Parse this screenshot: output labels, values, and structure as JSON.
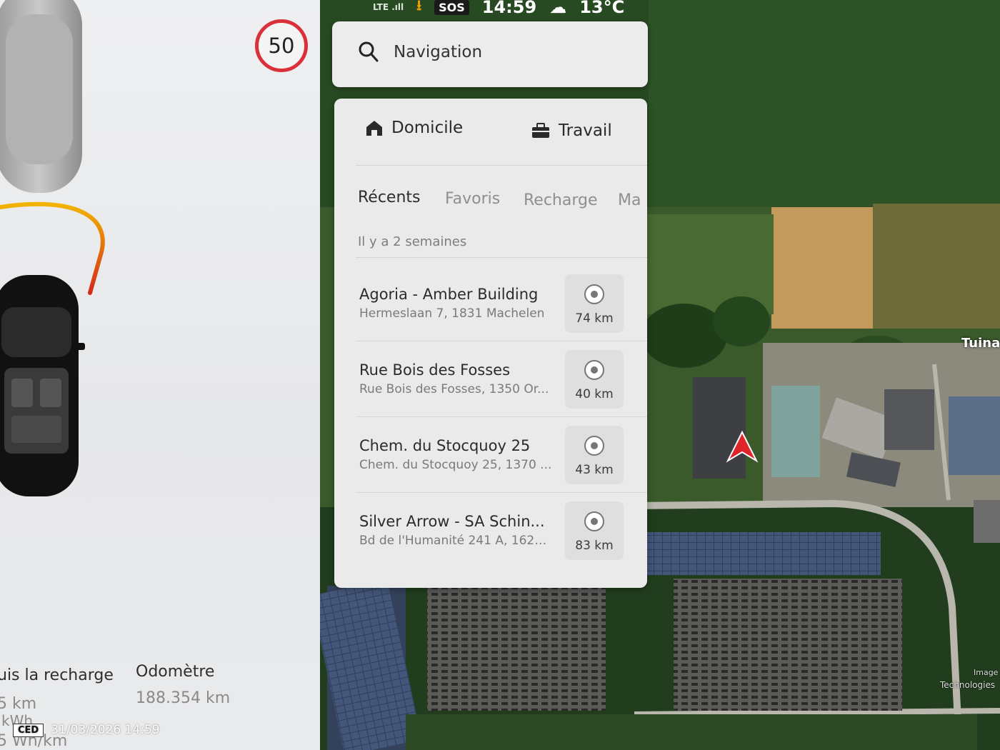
{
  "status_bar": {
    "network": "LTE .ıll",
    "sos": "SOS",
    "time": "14:59",
    "temperature": "13°C"
  },
  "vehicle": {
    "speed_limit": "50",
    "stats": {
      "since_charge_label": "uis la recharge",
      "since_charge_distance": "5 km",
      "since_charge_energy": "kWh",
      "since_charge_efficiency": "5 Wh/km",
      "odometer_label": "Odomètre",
      "odometer_value": "188.354 km"
    }
  },
  "search": {
    "placeholder": "Navigation"
  },
  "quick_destinations": {
    "home_label": "Domicile",
    "work_label": "Travail"
  },
  "tabs": [
    {
      "label": "Récents",
      "active": true
    },
    {
      "label": "Favoris",
      "active": false
    },
    {
      "label": "Recharge",
      "active": false
    },
    {
      "label": "Ma",
      "active": false
    }
  ],
  "recent_header": "Il y a 2 semaines",
  "destinations": [
    {
      "name": "Agoria - Amber Building",
      "address": "Hermeslaan 7, 1831 Machelen",
      "distance": "74 km"
    },
    {
      "name": "Rue Bois des Fosses",
      "address": "Rue Bois des Fosses, 1350 Or...",
      "distance": "40 km"
    },
    {
      "name": "Chem. du Stocquoy 25",
      "address": "Chem. du Stocquoy 25, 1370 ...",
      "distance": "43 km"
    },
    {
      "name": "Silver Arrow - SA Schin...",
      "address": "Bd de l'Humanité 241 A, 1620...",
      "distance": "83 km"
    }
  ],
  "map": {
    "place_label": "Tuinaa",
    "tech_label": "Technologies",
    "tech_label_top": "Image"
  },
  "watermark": {
    "logo": "CED",
    "timestamp": "31/03/2026 14:59"
  },
  "colors": {
    "speed_limit_ring": "#d9303a",
    "nav_arrow": "#e0242a",
    "panel_bg": "#eaeaeb"
  }
}
